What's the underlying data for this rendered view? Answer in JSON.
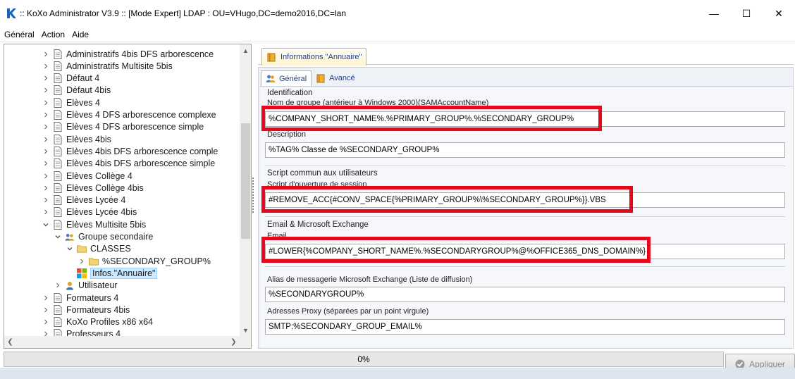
{
  "window": {
    "title": ":: KoXo Administrator V3.9 :: [Mode Expert] LDAP : OU=VHugo,DC=demo2016,DC=lan",
    "minimize": "—",
    "maximize": "☐",
    "close": "✕"
  },
  "menu": [
    "Général",
    "Action",
    "Aide"
  ],
  "tree": {
    "items": [
      {
        "label": "Administratifs 4bis DFS arborescence",
        "indent": 1,
        "chevron": "right",
        "icon": "document-icon"
      },
      {
        "label": "Administratifs Multisite 5bis",
        "indent": 1,
        "chevron": "right",
        "icon": "document-icon"
      },
      {
        "label": "Défaut 4",
        "indent": 1,
        "chevron": "right",
        "icon": "document-icon"
      },
      {
        "label": "Défaut 4bis",
        "indent": 1,
        "chevron": "right",
        "icon": "document-icon"
      },
      {
        "label": "Elèves 4",
        "indent": 1,
        "chevron": "right",
        "icon": "document-icon"
      },
      {
        "label": "Elèves 4 DFS arborescence complexe",
        "indent": 1,
        "chevron": "right",
        "icon": "document-icon"
      },
      {
        "label": "Elèves 4 DFS arborescence simple",
        "indent": 1,
        "chevron": "right",
        "icon": "document-icon"
      },
      {
        "label": "Elèves 4bis",
        "indent": 1,
        "chevron": "right",
        "icon": "document-icon"
      },
      {
        "label": "Elèves 4bis DFS arborescence comple",
        "indent": 1,
        "chevron": "right",
        "icon": "document-icon"
      },
      {
        "label": "Elèves 4bis DFS arborescence simple",
        "indent": 1,
        "chevron": "right",
        "icon": "document-icon"
      },
      {
        "label": "Elèves Collège 4",
        "indent": 1,
        "chevron": "right",
        "icon": "document-icon"
      },
      {
        "label": "Elèves Collège 4bis",
        "indent": 1,
        "chevron": "right",
        "icon": "document-icon"
      },
      {
        "label": "Elèves Lycée 4",
        "indent": 1,
        "chevron": "right",
        "icon": "document-icon"
      },
      {
        "label": "Elèves Lycée 4bis",
        "indent": 1,
        "chevron": "right",
        "icon": "document-icon"
      },
      {
        "label": "Elèves Multisite 5bis",
        "indent": 1,
        "chevron": "down",
        "icon": "document-icon"
      },
      {
        "label": "Groupe secondaire",
        "indent": 2,
        "chevron": "down",
        "icon": "group-icon"
      },
      {
        "label": "CLASSES",
        "indent": 3,
        "chevron": "down",
        "icon": "folder-icon"
      },
      {
        "label": "%SECONDARY_GROUP%",
        "indent": 4,
        "chevron": "right",
        "icon": "folder-icon"
      },
      {
        "label": "Infos.\"Annuaire\"",
        "indent": 3,
        "chevron": "none",
        "icon": "windows-icon",
        "selected": true
      },
      {
        "label": "Utilisateur",
        "indent": 2,
        "chevron": "right",
        "icon": "user-icon"
      },
      {
        "label": "Formateurs 4",
        "indent": 1,
        "chevron": "right",
        "icon": "document-icon"
      },
      {
        "label": "Formateurs 4bis",
        "indent": 1,
        "chevron": "right",
        "icon": "document-icon"
      },
      {
        "label": "KoXo Profiles x86 x64",
        "indent": 1,
        "chevron": "right",
        "icon": "document-icon"
      },
      {
        "label": "Professeurs 4",
        "indent": 1,
        "chevron": "right",
        "icon": "document-icon"
      }
    ]
  },
  "main_tab": "Informations \"Annuaire\"",
  "subtabs": [
    "Général",
    "Avancé"
  ],
  "form": {
    "identification": {
      "group_title": "Identification",
      "name_label": "Nom de groupe (antérieur à Windows 2000)(SAMAccountName)",
      "name_value": "%COMPANY_SHORT_NAME%.%PRIMARY_GROUP%.%SECONDARY_GROUP%",
      "desc_label": "Description",
      "desc_value": "%TAG% Classe de %SECONDARY_GROUP%"
    },
    "script": {
      "group_title": "Script commun aux utilisateurs",
      "label": "Script d'ouverture de session",
      "value": "#REMOVE_ACC{#CONV_SPACE{%PRIMARY_GROUP%\\%SECONDARY_GROUP%}}.VBS"
    },
    "email": {
      "group_title": "Email & Microsoft Exchange",
      "label": "Email",
      "value": "#LOWER{%COMPANY_SHORT_NAME%.%SECONDARYGROUP%@%OFFICE365_DNS_DOMAIN%}",
      "alias_label": "Alias de messagerie Microsoft Exchange (Liste de diffusion)",
      "alias_value": "%SECONDARYGROUP%",
      "proxy_label": "Adresses Proxy (séparées par un point virgule)",
      "proxy_value": "SMTP:%SECONDARY_GROUP_EMAIL%"
    }
  },
  "progress": {
    "text": "0%",
    "value": 0
  },
  "apply_label": "Appliquer",
  "colors": {
    "highlight_box": "#e8071a",
    "tab_text": "#1f3f8f",
    "selection": "#cce8ff"
  }
}
